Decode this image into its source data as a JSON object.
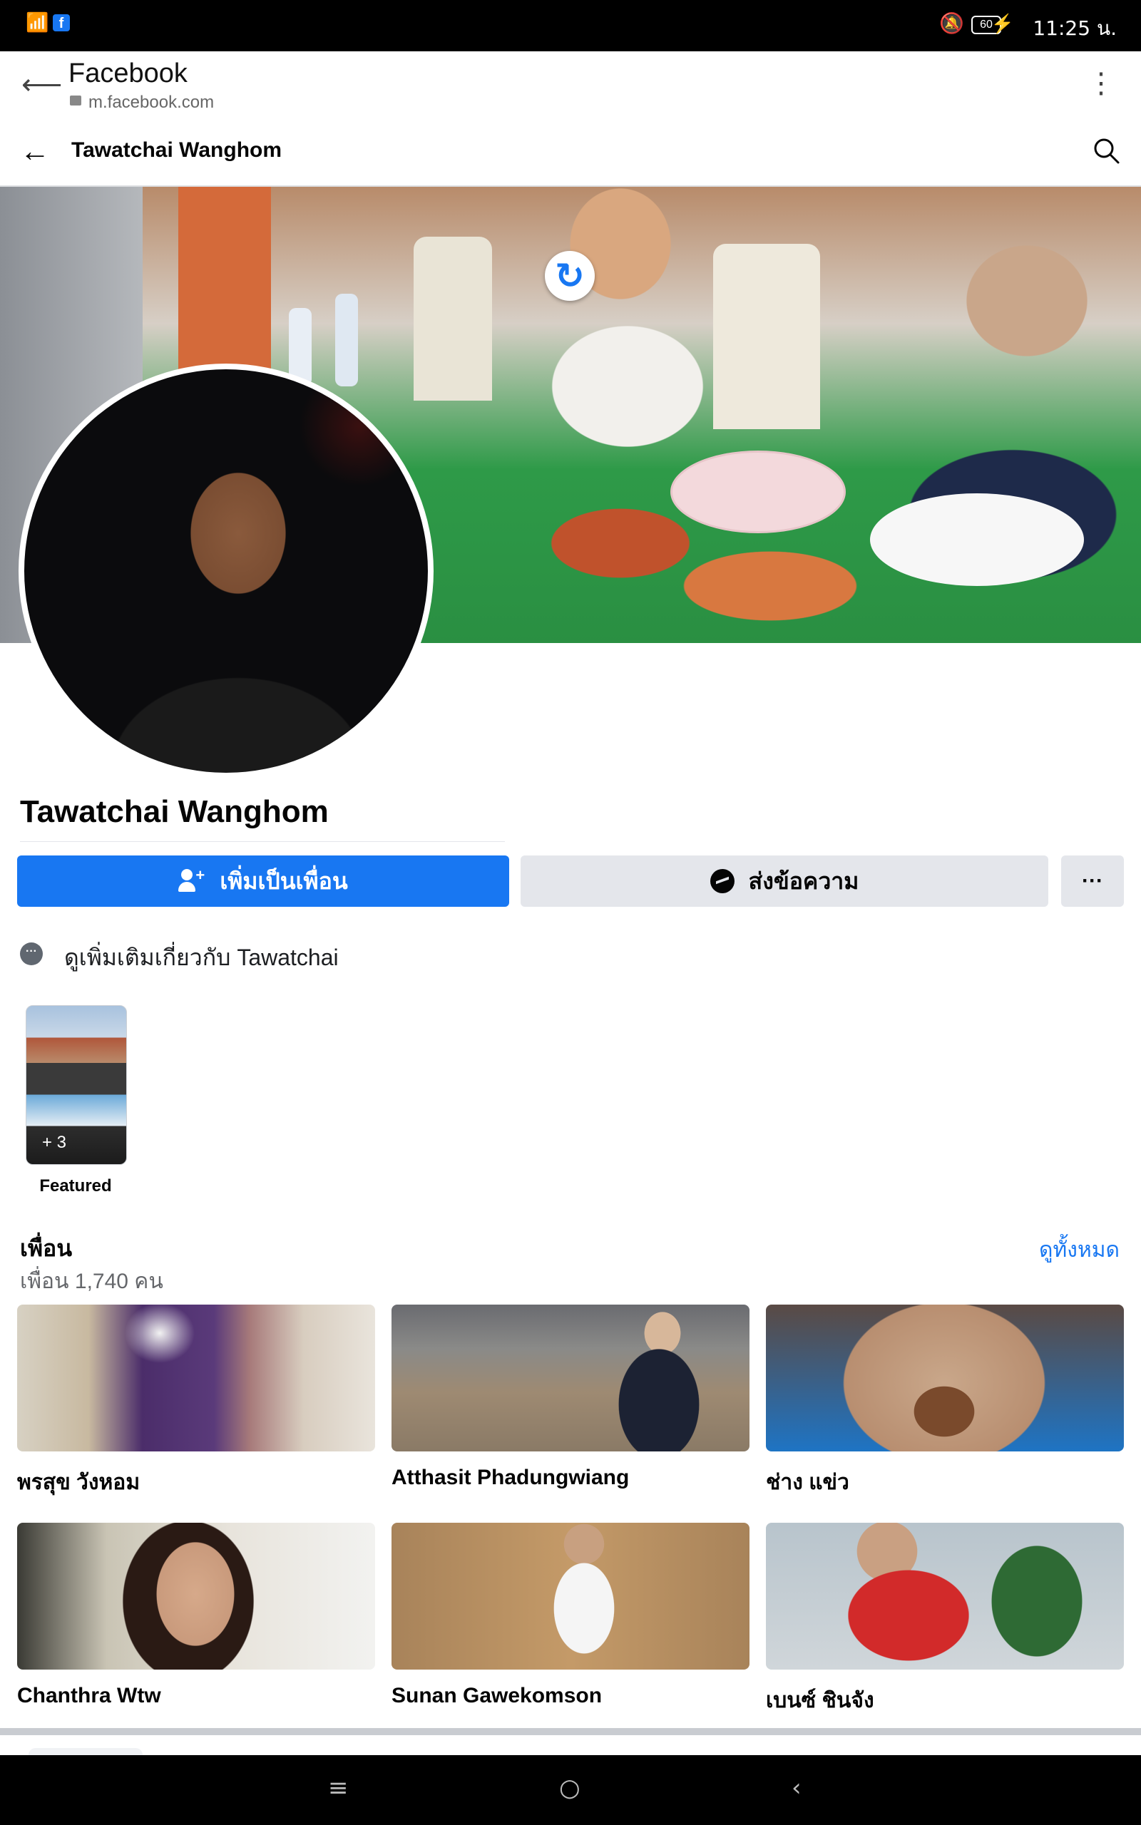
{
  "status_bar": {
    "time": "11:25 น.",
    "battery": "60",
    "icons": [
      "wifi-icon",
      "facebook-notification-icon",
      "mute-bell-icon",
      "battery-icon",
      "charging-icon"
    ]
  },
  "browser": {
    "title": "Facebook",
    "url": "m.facebook.com"
  },
  "profile_header": {
    "name": "Tawatchai Wanghom"
  },
  "profile": {
    "name": "Tawatchai Wanghom",
    "add_friend_label": "เพิ่มเป็นเพื่อน",
    "message_label": "ส่งข้อความ",
    "more_label": "···",
    "about_label": "ดูเพิ่มเติมเกี่ยวกับ Tawatchai"
  },
  "featured": {
    "count_label": "+ 3",
    "label": "Featured"
  },
  "friends": {
    "title": "เพื่อน",
    "count": "เพื่อน 1,740 คน",
    "see_all": "ดูทั้งหมด",
    "items": [
      {
        "name": "พรสุข วังหอม"
      },
      {
        "name": "Atthasit Phadungwiang"
      },
      {
        "name": "ช่าง แข่ว"
      },
      {
        "name": "Chanthra Wtw"
      },
      {
        "name": "Sunan Gawekomson"
      },
      {
        "name": "เบนซ์ ชินจัง"
      }
    ]
  },
  "colors": {
    "accent": "#1877f2",
    "secondary_button": "#e4e6eb",
    "muted_text": "#65676b"
  }
}
